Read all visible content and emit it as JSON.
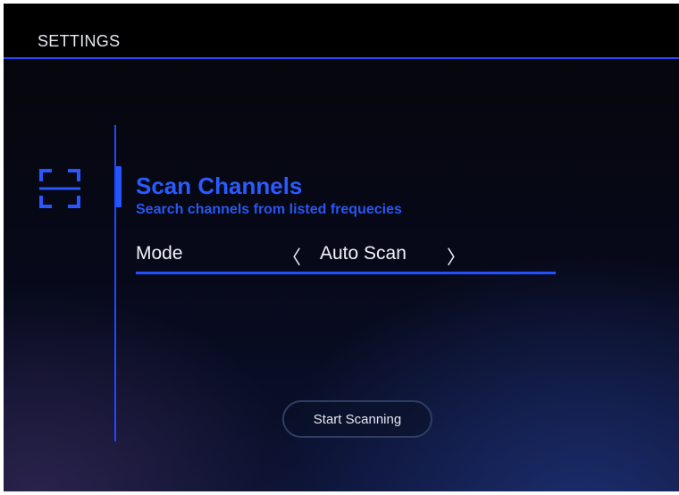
{
  "header": {
    "title": "SETTINGS"
  },
  "sidebar": {
    "icon": "scan-frame-icon"
  },
  "section": {
    "title": "Scan Channels",
    "subtitle": "Search channels from listed frequecies"
  },
  "mode": {
    "label": "Mode",
    "value": "Auto Scan",
    "prev_arrow": "〈",
    "next_arrow": "〉"
  },
  "actions": {
    "start_label": "Start Scanning"
  },
  "colors": {
    "accent": "#1f49ff",
    "accent_text": "#2b5bff",
    "background": "#050509"
  }
}
